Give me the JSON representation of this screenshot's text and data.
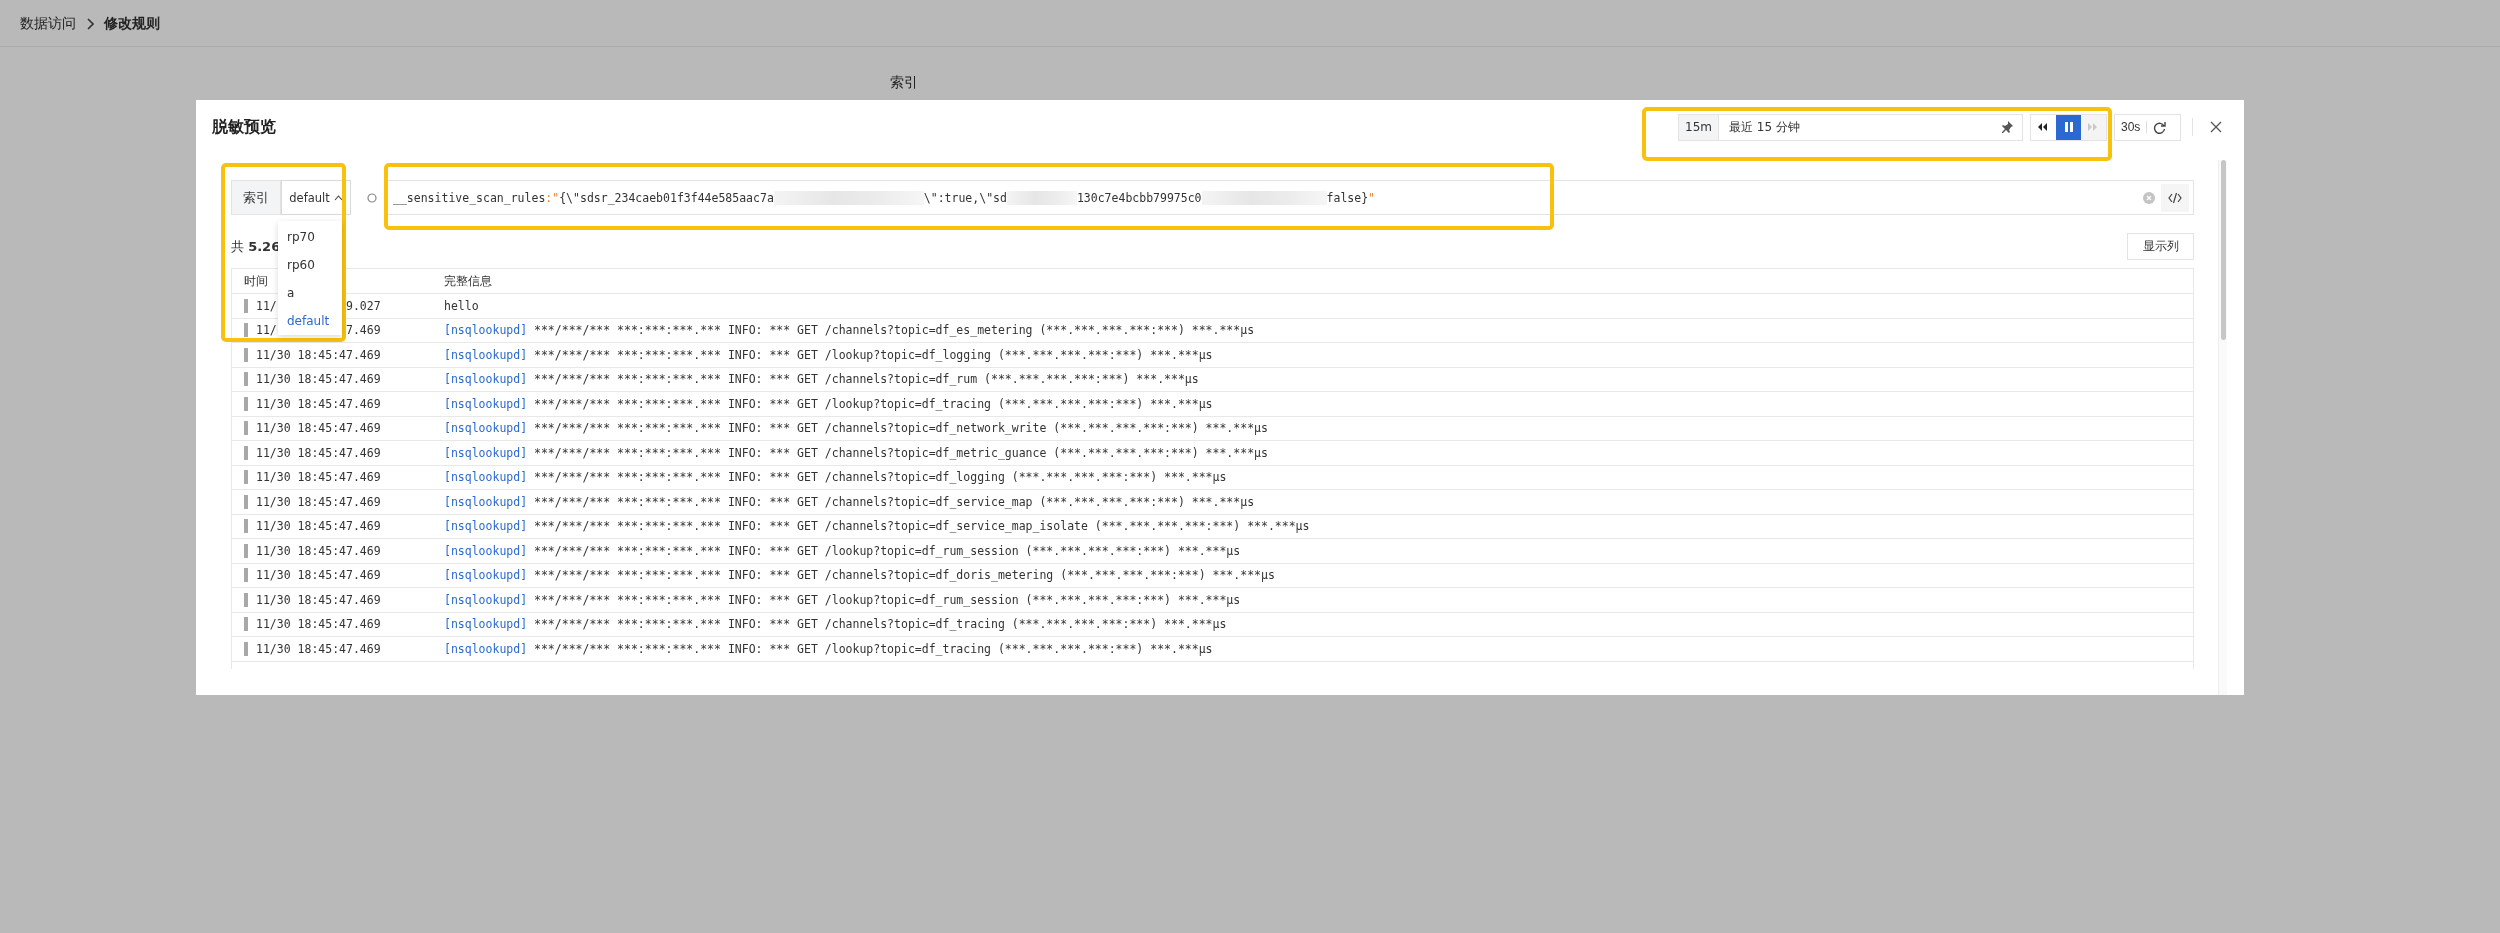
{
  "breadcrumb": [
    {
      "label": "数据访问"
    },
    {
      "label": "修改规则"
    }
  ],
  "background_label": "索引",
  "modal": {
    "title": "脱敏预览",
    "time_range": {
      "quick": "15m",
      "value": "最近 15 分钟"
    },
    "playback": [
      {
        "kind": "rewind",
        "selected": false,
        "disabled": false
      },
      {
        "kind": "pause",
        "selected": true,
        "disabled": false
      },
      {
        "kind": "forward",
        "selected": false,
        "disabled": true
      }
    ],
    "refresh": {
      "interval": "30s"
    },
    "index_label": "索引",
    "index_select": {
      "value": "default",
      "expanded": true
    },
    "index_options": [
      {
        "label": "rp70",
        "selected": false
      },
      {
        "label": "rp60",
        "selected": false
      },
      {
        "label": "a",
        "selected": false
      },
      {
        "label": "default",
        "selected": true
      }
    ],
    "query": [
      {
        "kind": "key",
        "text": "__sensitive_scan_rules"
      },
      {
        "kind": "operator",
        "text": ":\""
      },
      {
        "kind": "text",
        "text": "{\\\"sdsr_234caeb01f3f44e585aac7a"
      },
      {
        "kind": "redacted"
      },
      {
        "kind": "text",
        "text": "\\\":true,\\\"sd"
      },
      {
        "kind": "redacted"
      },
      {
        "kind": "text",
        "text": "130c7e4bcbb79975c0"
      },
      {
        "kind": "redacted"
      },
      {
        "kind": "text",
        "text": "false}"
      },
      {
        "kind": "operator",
        "text": "\""
      }
    ],
    "count": "共 **5.26**",
    "columns_button": "显示列",
    "columns": [
      "时间",
      "完整信息"
    ],
    "rows": [
      {
        "time": "11/",
        "time_tail": "9.027",
        "message": [
          {
            "kind": "text",
            "text": "hello"
          }
        ]
      },
      {
        "time": "11/",
        "time_tail": "7.469",
        "message": [
          {
            "kind": "source",
            "text": "[nsqlookupd]"
          },
          {
            "kind": "text",
            "text": "***/***/*** ***:***:***.*** INFO: *** GET /channels?topic=df_es_metering (***.***.***.***:***) ***.***µs"
          }
        ]
      },
      {
        "time": "11/30 18:45:47.469",
        "message": [
          {
            "kind": "source",
            "text": "[nsqlookupd]"
          },
          {
            "kind": "text",
            "text": "***/***/*** ***:***:***.*** INFO: *** GET /lookup?topic=df_logging (***.***.***.***:***) ***.***µs"
          }
        ]
      },
      {
        "time": "11/30 18:45:47.469",
        "message": [
          {
            "kind": "source",
            "text": "[nsqlookupd]"
          },
          {
            "kind": "text",
            "text": "***/***/*** ***:***:***.*** INFO: *** GET /channels?topic=df_rum (***.***.***.***:***) ***.***µs"
          }
        ]
      },
      {
        "time": "11/30 18:45:47.469",
        "message": [
          {
            "kind": "source",
            "text": "[nsqlookupd]"
          },
          {
            "kind": "text",
            "text": "***/***/*** ***:***:***.*** INFO: *** GET /lookup?topic=df_tracing (***.***.***.***:***) ***.***µs"
          }
        ]
      },
      {
        "time": "11/30 18:45:47.469",
        "message": [
          {
            "kind": "source",
            "text": "[nsqlookupd]"
          },
          {
            "kind": "text",
            "text": "***/***/*** ***:***:***.*** INFO: *** GET /channels?topic=df_network_write (***.***.***.***:***) ***.***µs"
          }
        ]
      },
      {
        "time": "11/30 18:45:47.469",
        "message": [
          {
            "kind": "source",
            "text": "[nsqlookupd]"
          },
          {
            "kind": "text",
            "text": "***/***/*** ***:***:***.*** INFO: *** GET /channels?topic=df_metric_guance (***.***.***.***:***) ***.***µs"
          }
        ]
      },
      {
        "time": "11/30 18:45:47.469",
        "message": [
          {
            "kind": "source",
            "text": "[nsqlookupd]"
          },
          {
            "kind": "text",
            "text": "***/***/*** ***:***:***.*** INFO: *** GET /channels?topic=df_logging (***.***.***.***:***) ***.***µs"
          }
        ]
      },
      {
        "time": "11/30 18:45:47.469",
        "message": [
          {
            "kind": "source",
            "text": "[nsqlookupd]"
          },
          {
            "kind": "text",
            "text": "***/***/*** ***:***:***.*** INFO: *** GET /channels?topic=df_service_map (***.***.***.***:***) ***.***µs"
          }
        ]
      },
      {
        "time": "11/30 18:45:47.469",
        "message": [
          {
            "kind": "source",
            "text": "[nsqlookupd]"
          },
          {
            "kind": "text",
            "text": "***/***/*** ***:***:***.*** INFO: *** GET /channels?topic=df_service_map_isolate (***.***.***.***:***) ***.***µs"
          }
        ]
      },
      {
        "time": "11/30 18:45:47.469",
        "message": [
          {
            "kind": "source",
            "text": "[nsqlookupd]"
          },
          {
            "kind": "text",
            "text": "***/***/*** ***:***:***.*** INFO: *** GET /lookup?topic=df_rum_session (***.***.***.***:***) ***.***µs"
          }
        ]
      },
      {
        "time": "11/30 18:45:47.469",
        "message": [
          {
            "kind": "source",
            "text": "[nsqlookupd]"
          },
          {
            "kind": "text",
            "text": "***/***/*** ***:***:***.*** INFO: *** GET /channels?topic=df_doris_metering (***.***.***.***:***) ***.***µs"
          }
        ]
      },
      {
        "time": "11/30 18:45:47.469",
        "message": [
          {
            "kind": "source",
            "text": "[nsqlookupd]"
          },
          {
            "kind": "text",
            "text": "***/***/*** ***:***:***.*** INFO: *** GET /lookup?topic=df_rum_session (***.***.***.***:***) ***.***µs"
          }
        ]
      },
      {
        "time": "11/30 18:45:47.469",
        "message": [
          {
            "kind": "source",
            "text": "[nsqlookupd]"
          },
          {
            "kind": "text",
            "text": "***/***/*** ***:***:***.*** INFO: *** GET /channels?topic=df_tracing (***.***.***.***:***) ***.***µs"
          }
        ]
      },
      {
        "time": "11/30 18:45:47.469",
        "message": [
          {
            "kind": "source",
            "text": "[nsqlookupd]"
          },
          {
            "kind": "text",
            "text": "***/***/*** ***:***:***.*** INFO: *** GET /lookup?topic=df_tracing (***.***.***.***:***) ***.***µs"
          }
        ]
      }
    ]
  },
  "annotations": [
    {
      "kind": "highlight"
    },
    {
      "kind": "highlight"
    },
    {
      "kind": "highlight"
    }
  ]
}
